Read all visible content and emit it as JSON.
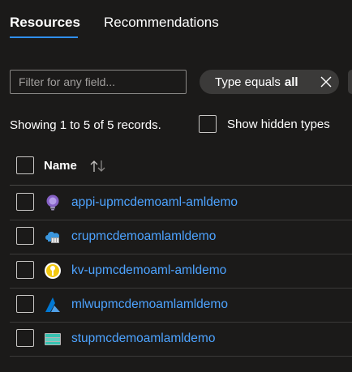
{
  "tabs": [
    {
      "label": "Resources",
      "active": true
    },
    {
      "label": "Recommendations",
      "active": false
    }
  ],
  "filter": {
    "placeholder": "Filter for any field...",
    "value": ""
  },
  "type_filter": {
    "prefix": "Type equals",
    "value": "all"
  },
  "summary": {
    "showing_text": "Showing 1 to 5 of 5 records."
  },
  "hidden_types": {
    "label": "Show hidden types",
    "checked": false
  },
  "table": {
    "columns": [
      {
        "label": "Name",
        "sort": "ascending"
      }
    ],
    "rows": [
      {
        "name": "appi-upmcdemoaml-amldemo",
        "icon": "app-insights-icon"
      },
      {
        "name": "crupmcdemoamlamldemo",
        "icon": "container-registry-icon"
      },
      {
        "name": "kv-upmcdemoaml-amldemo",
        "icon": "key-vault-icon"
      },
      {
        "name": "mlwupmcdemoamlamldemo",
        "icon": "machine-learning-icon"
      },
      {
        "name": "stupmcdemoamlamldemo",
        "icon": "storage-account-icon"
      }
    ]
  },
  "colors": {
    "accent": "#2f8ff0",
    "link": "#4da3ff",
    "background": "#1b1a19"
  }
}
